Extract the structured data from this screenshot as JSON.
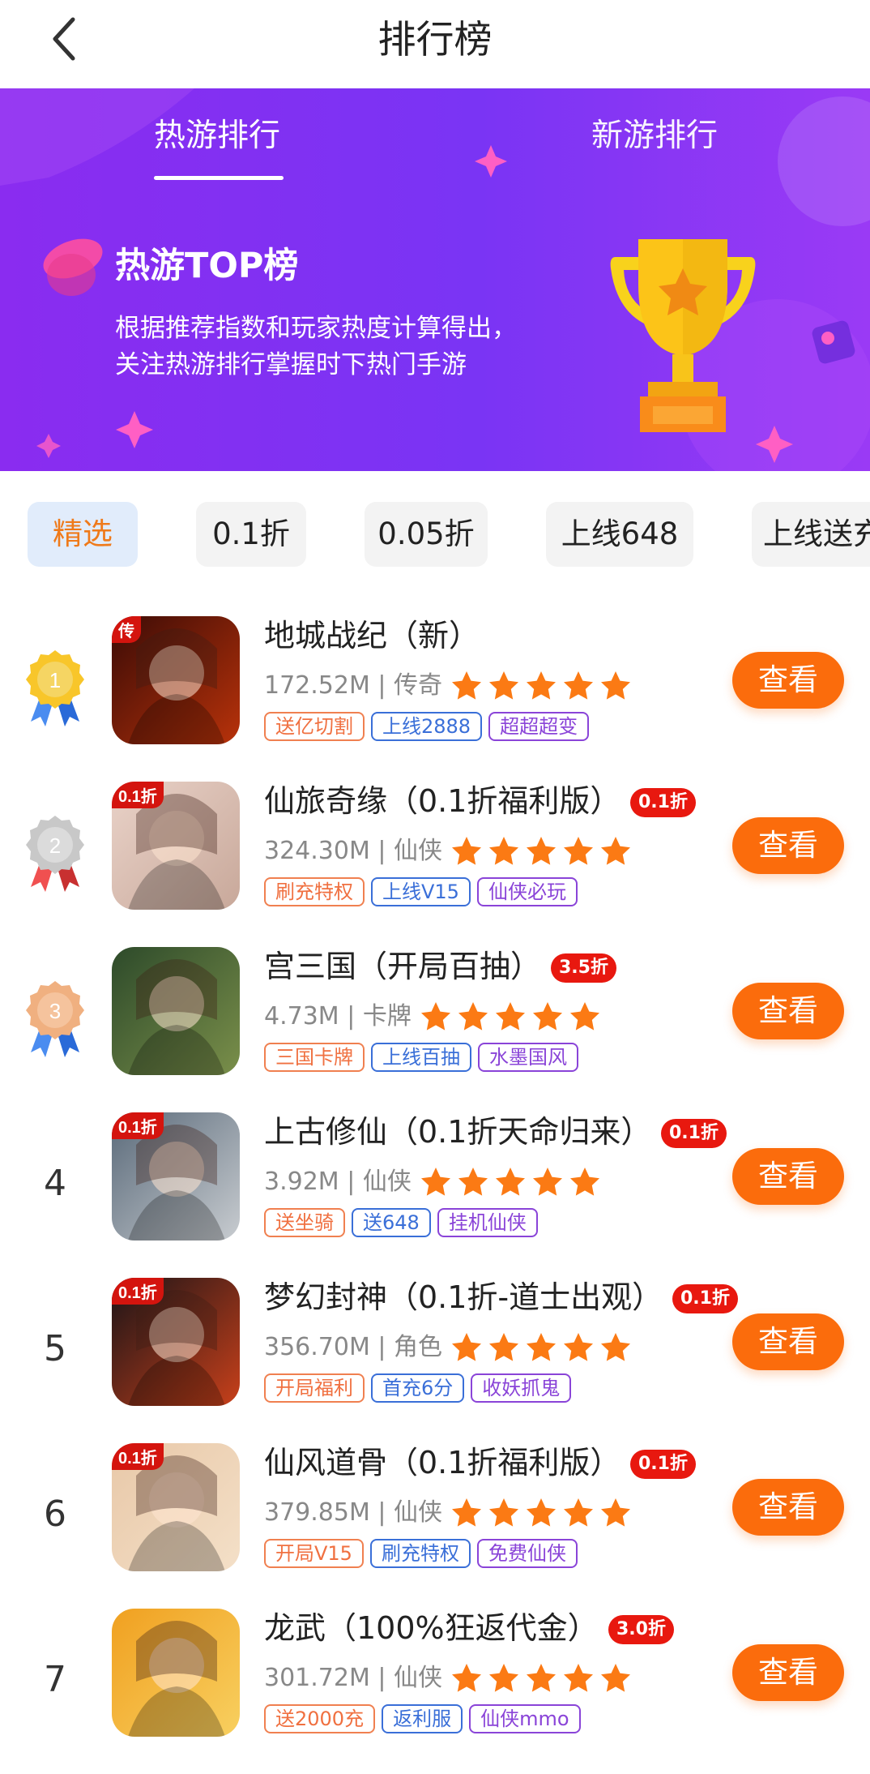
{
  "header": {
    "title": "排行榜",
    "back_icon": "chevron-left-icon"
  },
  "banner": {
    "tabs": [
      {
        "label": "热游排行",
        "active": true
      },
      {
        "label": "新游排行",
        "active": false
      }
    ],
    "title": "热游TOP榜",
    "desc_line1": "根据推荐指数和玩家热度计算得出，",
    "desc_line2": "关注热游排行掌握时下热门手游",
    "trophy_icon": "trophy-icon"
  },
  "filters": [
    {
      "label": "精选",
      "active": true
    },
    {
      "label": "0.1折",
      "active": false
    },
    {
      "label": "0.05折",
      "active": false
    },
    {
      "label": "上线648",
      "active": false
    },
    {
      "label": "上线送充",
      "active": false
    }
  ],
  "games": [
    {
      "rank": "1",
      "name": "地城战纪（新）",
      "discount": "",
      "size": "172.52M",
      "genre": "传奇",
      "rating": 5,
      "tags": [
        {
          "text": "送亿切割",
          "color": "orange"
        },
        {
          "text": "上线2888",
          "color": "blue"
        },
        {
          "text": "超超超变",
          "color": "purple"
        }
      ],
      "icon_colors": [
        "#3b0b06",
        "#b8320a"
      ],
      "icon_text": "传",
      "button": "查看"
    },
    {
      "rank": "2",
      "name": "仙旅奇缘（0.1折福利版）",
      "discount": "0.1折",
      "size": "324.30M",
      "genre": "仙侠",
      "rating": 5,
      "tags": [
        {
          "text": "刷充特权",
          "color": "orange"
        },
        {
          "text": "上线V15",
          "color": "blue"
        },
        {
          "text": "仙侠必玩",
          "color": "purple"
        }
      ],
      "icon_colors": [
        "#e9d2c8",
        "#c8a89a"
      ],
      "icon_text": "0.1折",
      "button": "查看"
    },
    {
      "rank": "3",
      "name": "宫三国（开局百抽）",
      "discount": "3.5折",
      "size": "4.73M",
      "genre": "卡牌",
      "rating": 5,
      "tags": [
        {
          "text": "三国卡牌",
          "color": "orange"
        },
        {
          "text": "上线百抽",
          "color": "blue"
        },
        {
          "text": "水墨国风",
          "color": "purple"
        }
      ],
      "icon_colors": [
        "#2d4a2a",
        "#7a8f4a"
      ],
      "icon_text": "",
      "button": "查看"
    },
    {
      "rank": "4",
      "name": "上古修仙（0.1折天命归来）",
      "discount": "0.1折",
      "size": "3.92M",
      "genre": "仙侠",
      "rating": 5,
      "tags": [
        {
          "text": "送坐骑",
          "color": "orange"
        },
        {
          "text": "送648",
          "color": "blue"
        },
        {
          "text": "挂机仙侠",
          "color": "purple"
        }
      ],
      "icon_colors": [
        "#5a6a7a",
        "#c8ccd0"
      ],
      "icon_text": "0.1折",
      "button": "查看"
    },
    {
      "rank": "5",
      "name": "梦幻封神（0.1折-道士出观）",
      "discount": "0.1折",
      "size": "356.70M",
      "genre": "角色",
      "rating": 5,
      "tags": [
        {
          "text": "开局福利",
          "color": "orange"
        },
        {
          "text": "首充6分",
          "color": "blue"
        },
        {
          "text": "收妖抓鬼",
          "color": "purple"
        }
      ],
      "icon_colors": [
        "#1a1418",
        "#c8401a"
      ],
      "icon_text": "0.1折",
      "button": "查看"
    },
    {
      "rank": "6",
      "name": "仙风道骨（0.1折福利版）",
      "discount": "0.1折",
      "size": "379.85M",
      "genre": "仙侠",
      "rating": 5,
      "tags": [
        {
          "text": "开局V15",
          "color": "orange"
        },
        {
          "text": "刷充特权",
          "color": "blue"
        },
        {
          "text": "免费仙侠",
          "color": "purple"
        }
      ],
      "icon_colors": [
        "#e8c8a8",
        "#f4e0c8"
      ],
      "icon_text": "0.1折",
      "button": "查看"
    },
    {
      "rank": "7",
      "name": "龙武（100%狂返代金）",
      "discount": "3.0折",
      "size": "301.72M",
      "genre": "仙侠",
      "rating": 5,
      "tags": [
        {
          "text": "送2000充",
          "color": "orange"
        },
        {
          "text": "返利服",
          "color": "blue"
        },
        {
          "text": "仙侠mmo",
          "color": "purple"
        }
      ],
      "icon_colors": [
        "#f0a020",
        "#f8d060"
      ],
      "icon_text": "",
      "button": "查看"
    }
  ]
}
